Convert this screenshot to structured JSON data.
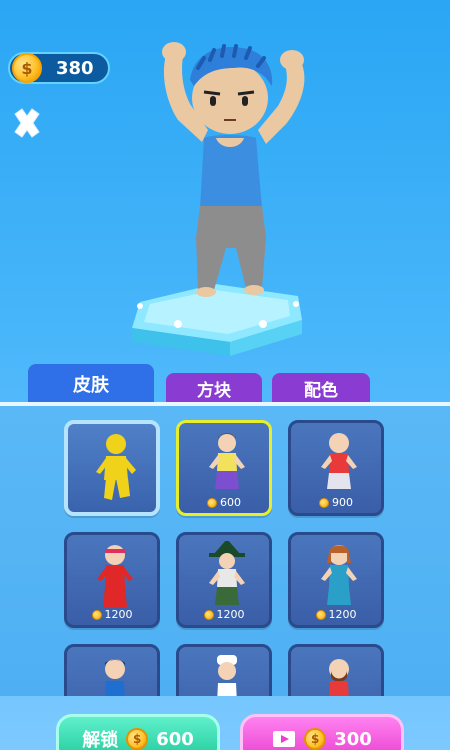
{
  "hud": {
    "coin_symbol": "$",
    "coins": "380",
    "close_icon": "close-icon"
  },
  "tabs": [
    {
      "label": "皮肤",
      "active": true
    },
    {
      "label": "方块",
      "active": false
    },
    {
      "label": "配色",
      "active": false
    }
  ],
  "skins": [
    {
      "price": "",
      "owned": true,
      "colors": {
        "body": "#f0d21a",
        "legs": "#f0d21a",
        "head": "#f0d21a",
        "hair": "none"
      }
    },
    {
      "price": "600",
      "owned": false,
      "equipped": true,
      "colors": {
        "body": "#f2e15a",
        "legs": "#7b4fd0",
        "head": "#f3d2b5",
        "hair": "#7a4b2a"
      }
    },
    {
      "price": "900",
      "owned": false,
      "colors": {
        "body": "#e83a3a",
        "legs": "#e4e4ef",
        "head": "#f3d2b5",
        "hair": "none"
      }
    },
    {
      "price": "1200",
      "owned": false,
      "colors": {
        "body": "#e02828",
        "legs": "#e02828",
        "head": "#f3d2b5",
        "hair": "#e03060"
      }
    },
    {
      "price": "1200",
      "owned": false,
      "colors": {
        "body": "#e8e8e8",
        "legs": "#3a6a3a",
        "head": "#f3d2b5",
        "hair": "#1a4a2a"
      }
    },
    {
      "price": "1200",
      "owned": false,
      "colors": {
        "body": "#2aa0c8",
        "legs": "#2aa0c8",
        "head": "#f3d2b5",
        "hair": "#b8612b"
      }
    },
    {
      "price": "",
      "owned": false,
      "colors": {
        "body": "#1e6fd0",
        "legs": "#1e6fd0",
        "head": "#f3d2b5",
        "hair": "#1a2a5a"
      }
    },
    {
      "price": "",
      "owned": false,
      "colors": {
        "body": "#ffffff",
        "legs": "#ffffff",
        "head": "#f3d2b5",
        "hair": "#ffffff"
      }
    },
    {
      "price": "",
      "owned": false,
      "colors": {
        "body": "#e83a3a",
        "legs": "#e83a3a",
        "head": "#f3d2b5",
        "hair": "#7a3a1a"
      }
    }
  ],
  "buttons": {
    "unlock_label": "解锁",
    "unlock_price": "600",
    "video_price": "300",
    "video_icon": "video-icon"
  },
  "colors": {
    "accent_blue": "#2f6fe8",
    "tab_purple": "#8a3bd2",
    "unlock_green": "#20c99a",
    "video_pink": "#e83fcf",
    "equipped_yellow": "#e7ef2a"
  }
}
